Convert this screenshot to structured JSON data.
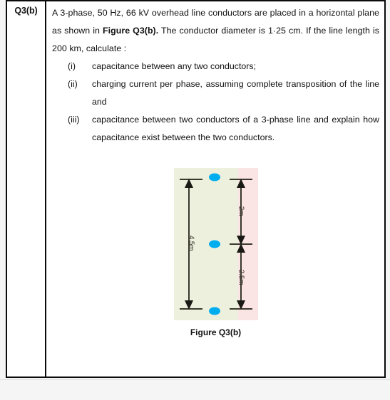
{
  "question": {
    "number_label": "Q3(b)",
    "intro_part_1": "A 3-phase, 50 Hz, 66 kV overhead line conductors are placed in a horizontal plane as shown in ",
    "intro_bold": "Figure Q3(b).",
    "intro_part_2": " The conductor diameter is 1·25 cm. If the line length is 200 km, calculate :",
    "sub_items": [
      {
        "marker": "(i)",
        "text": "capacitance between any two conductors;"
      },
      {
        "marker": "(ii)",
        "text": "charging current per phase, assuming complete transposition of the line and"
      },
      {
        "marker": "(iii)",
        "text": "capacitance between two conductors of a 3-phase line and explain how capacitance exist between the two conductors."
      }
    ]
  },
  "figure": {
    "caption": "Figure Q3(b)",
    "left_dimension": "4.5m",
    "right_dimension_top": "2m",
    "right_dimension_bottom": "2.5m",
    "conductor_count": 3,
    "colors": {
      "conductor": "#00AEEF",
      "background": "#eef0de",
      "accent_strip": "#fbe4e4",
      "line": "#3a3a2e"
    }
  }
}
